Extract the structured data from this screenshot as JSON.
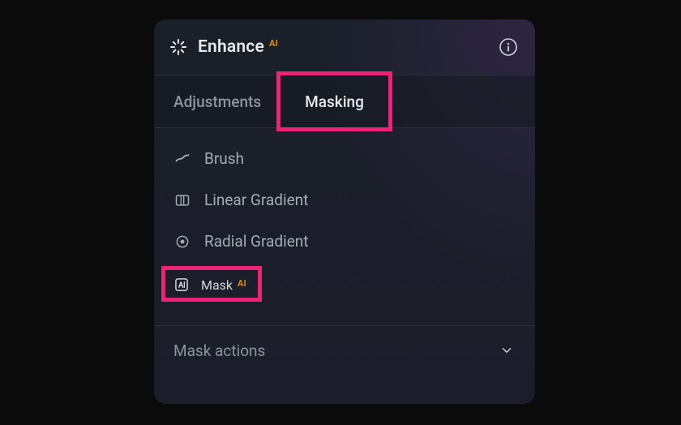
{
  "header": {
    "title": "Enhance",
    "ai_badge": "AI"
  },
  "tabs": {
    "adjustments": "Adjustments",
    "masking": "Masking",
    "active": "masking"
  },
  "tools": {
    "brush": "Brush",
    "linear_gradient": "Linear Gradient",
    "radial_gradient": "Radial Gradient",
    "mask_ai": "Mask",
    "mask_ai_badge": "AI"
  },
  "footer": {
    "mask_actions": "Mask actions"
  },
  "colors": {
    "highlight": "#ed2377",
    "ai_badge": "#d9891b"
  }
}
